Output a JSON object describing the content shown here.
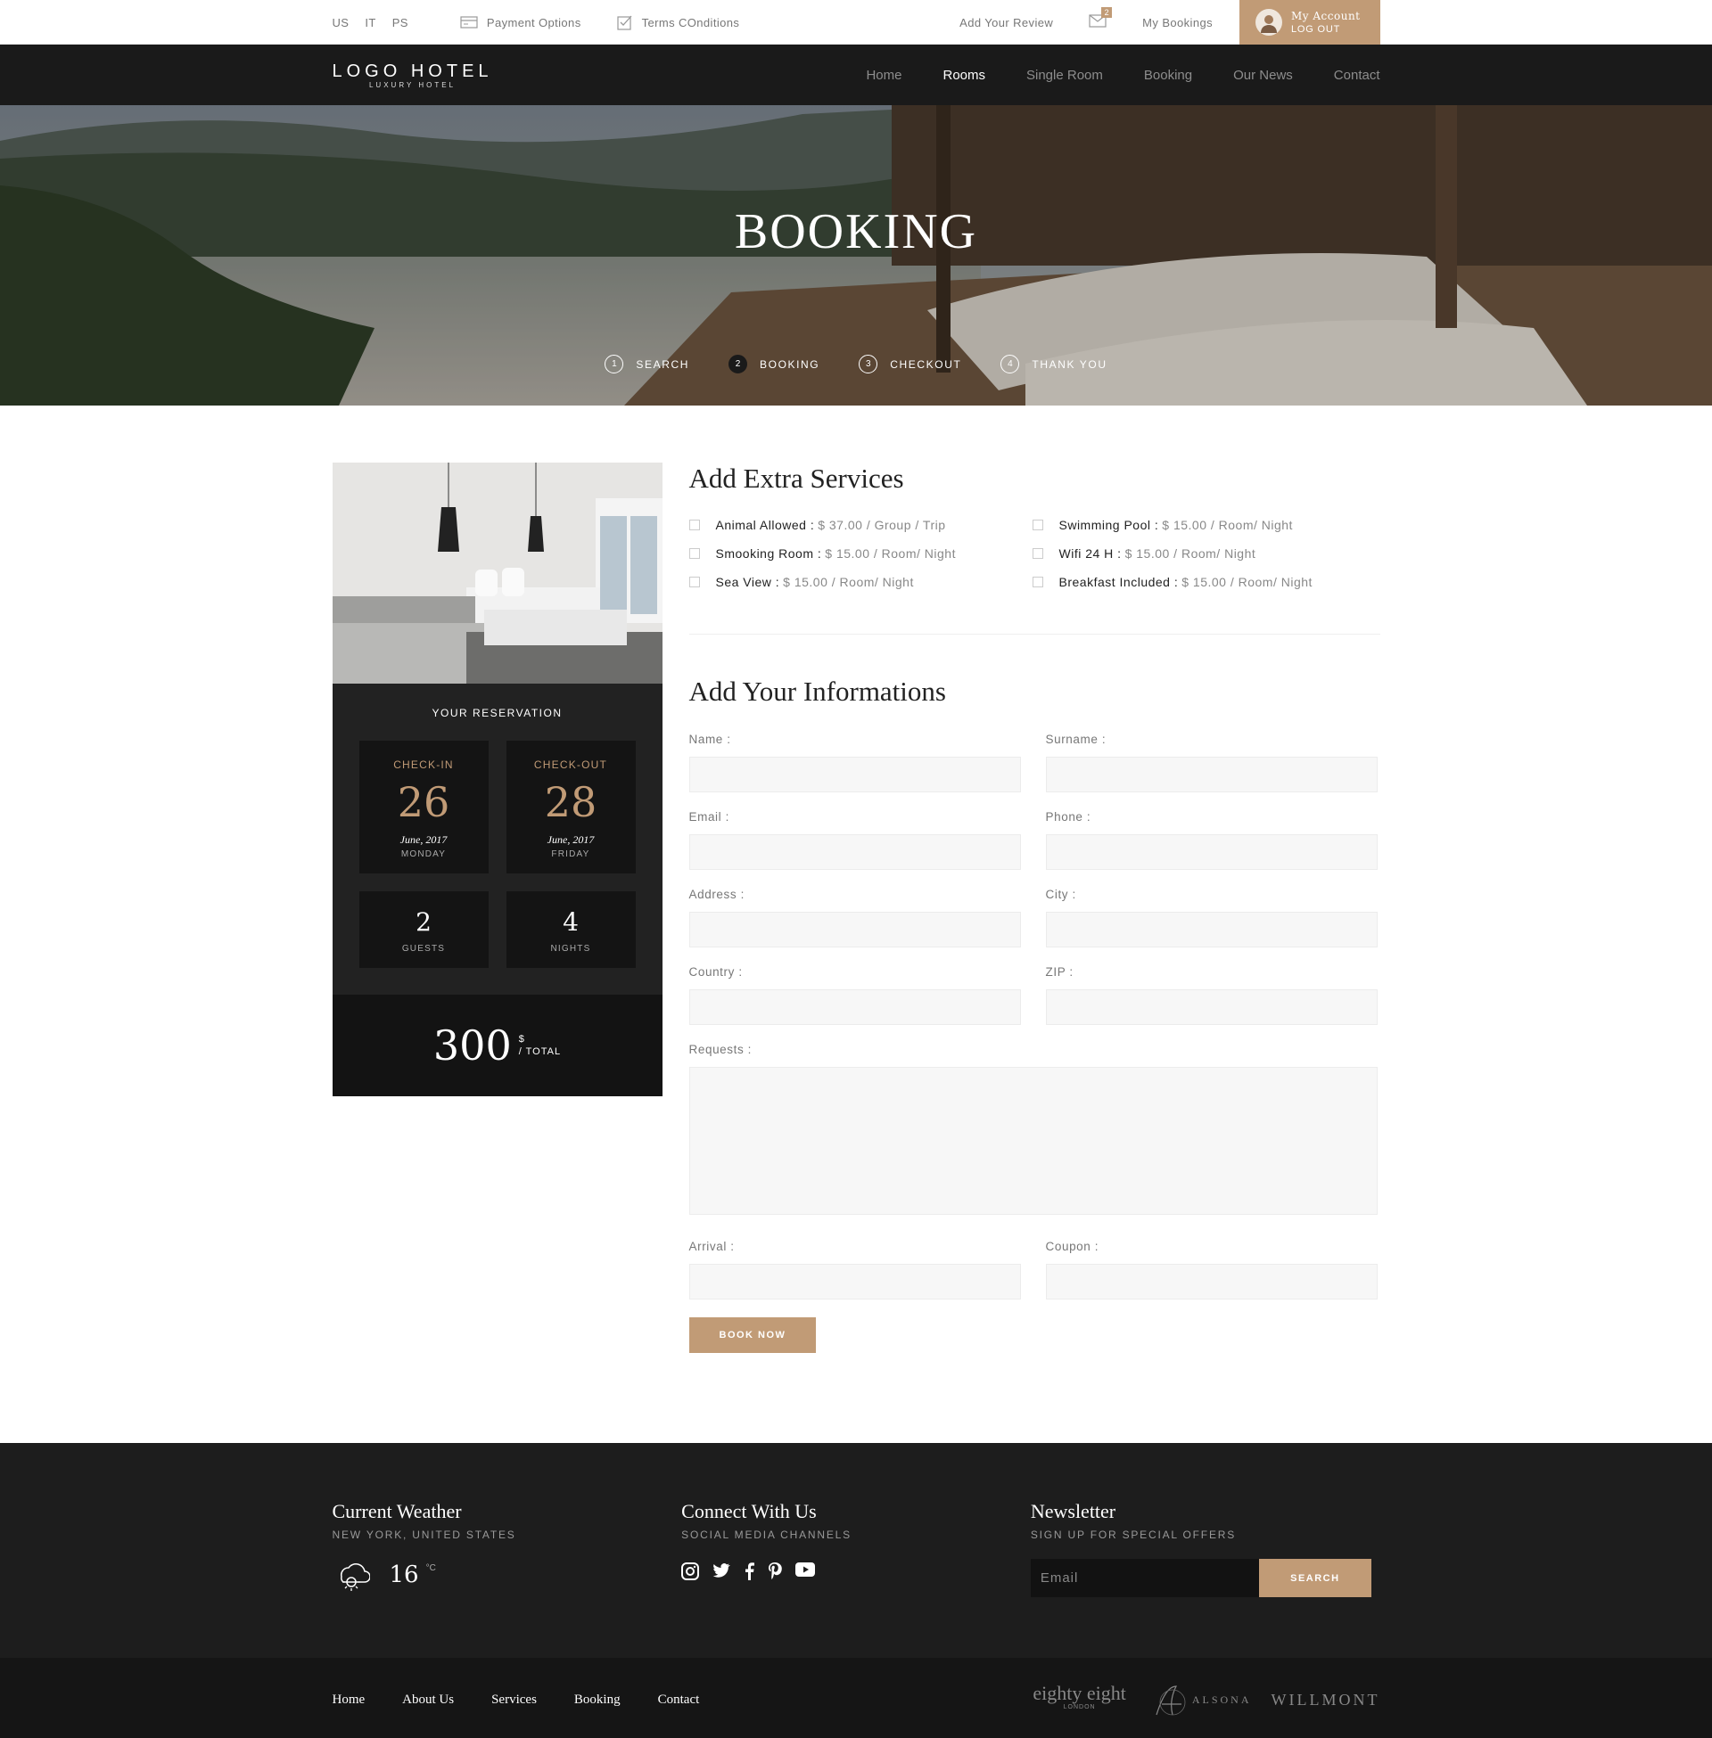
{
  "topbar": {
    "languages": [
      "US",
      "IT",
      "PS"
    ],
    "payment_options": "Payment Options",
    "terms": "Terms COnditions",
    "add_review": "Add Your Review",
    "mail_count": "2",
    "my_bookings": "My Bookings",
    "account": "My Account",
    "logout": "LOG OUT"
  },
  "nav": {
    "logo": "LOGO HOTEL",
    "logo_sub": "LUXURY HOTEL",
    "items": [
      "Home",
      "Rooms",
      "Single Room",
      "Booking",
      "Our News",
      "Contact"
    ],
    "active": "Rooms"
  },
  "hero": {
    "title": "BOOKING",
    "steps": [
      {
        "num": "1",
        "label": "SEARCH"
      },
      {
        "num": "2",
        "label": "BOOKING"
      },
      {
        "num": "3",
        "label": "CHECKOUT"
      },
      {
        "num": "4",
        "label": "THANK YOU"
      }
    ],
    "active_step": "2"
  },
  "reservation": {
    "heading": "YOUR RESERVATION",
    "checkin": {
      "label": "CHECK-IN",
      "day": "26",
      "date": "June, 2017",
      "weekday": "MONDAY"
    },
    "checkout": {
      "label": "CHECK-OUT",
      "day": "28",
      "date": "June, 2017",
      "weekday": "FRIDAY"
    },
    "guests": {
      "value": "2",
      "label": "GUESTS"
    },
    "nights": {
      "value": "4",
      "label": "NIGHTS"
    },
    "total": "300",
    "currency": "$",
    "total_label": "/ TOTAL"
  },
  "extras": {
    "heading": "Add Extra Services",
    "items": [
      {
        "name": "Animal Allowed :",
        "price": "$ 37.00 / Group / Trip"
      },
      {
        "name": "Swimming Pool :",
        "price": "$ 15.00 / Room/ Night"
      },
      {
        "name": "Smooking Room :",
        "price": "$ 15.00 / Room/ Night"
      },
      {
        "name": "Wifi 24 H :",
        "price": "$ 15.00 / Room/ Night"
      },
      {
        "name": "Sea View :",
        "price": "$ 15.00 / Room/ Night"
      },
      {
        "name": "Breakfast Included :",
        "price": "$ 15.00 / Room/ Night"
      }
    ]
  },
  "form": {
    "heading": "Add Your Informations",
    "name": "Name :",
    "surname": "Surname :",
    "email": "Email :",
    "phone": "Phone :",
    "address": "Address :",
    "city": "City :",
    "country": "Country :",
    "zip": "ZIP :",
    "requests": "Requests :",
    "arrival": "Arrival :",
    "coupon": "Coupon :",
    "submit": "BOOK NOW"
  },
  "footer": {
    "weather": {
      "title": "Current Weather",
      "sub": "NEW YORK, UNITED STATES",
      "temp": "16",
      "unit": "°C"
    },
    "connect": {
      "title": "Connect With Us",
      "sub": "SOCIAL MEDIA CHANNELS"
    },
    "newsletter": {
      "title": "Newsletter",
      "sub": "SIGN UP FOR SPECIAL OFFERS",
      "placeholder": "Email",
      "button": "SEARCH"
    },
    "links": [
      "Home",
      "About Us",
      "Services",
      "Booking",
      "Contact"
    ],
    "partners": {
      "p1": "eighty eight",
      "p1_sub": "LONDON",
      "p2": "ALSONA",
      "p3": "WILLMONT"
    }
  },
  "colors": {
    "accent": "#c19b76",
    "dark": "#1a1a1a"
  }
}
